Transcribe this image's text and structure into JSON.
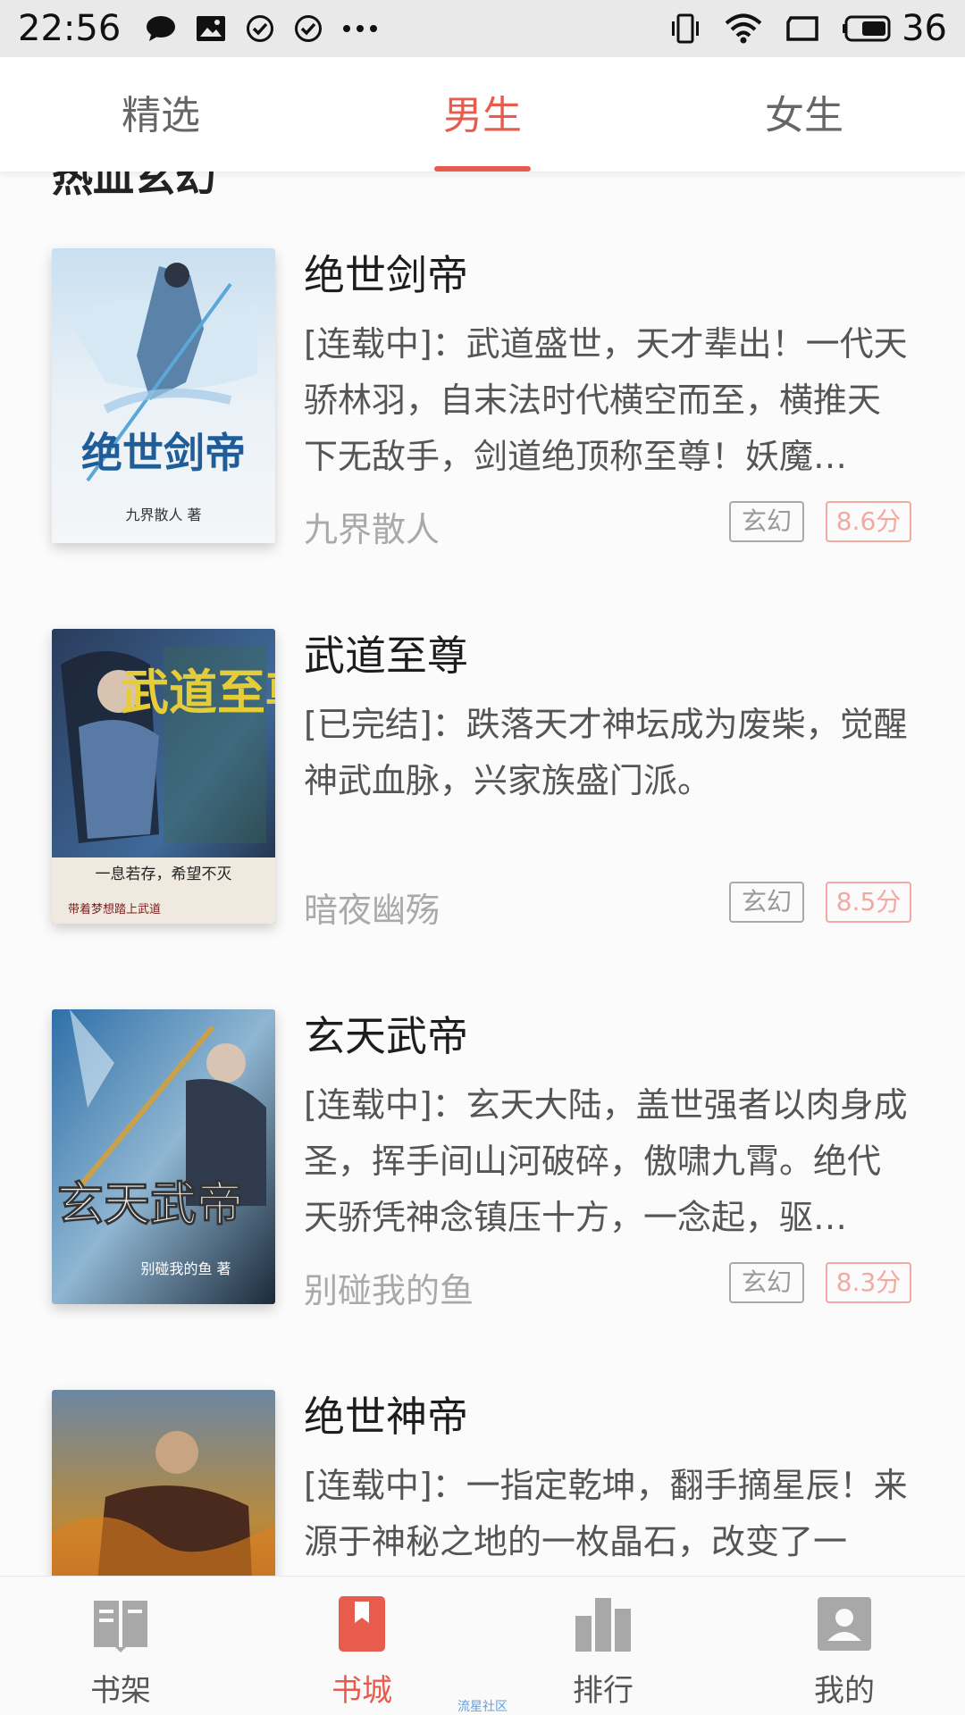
{
  "status_bar": {
    "time": "22:56",
    "icons": [
      "chat-bubble-icon",
      "image-notification-icon",
      "check-circle-icon",
      "check-circle-icon",
      "more-dots-icon"
    ],
    "right_icons": [
      "vibrate-icon",
      "wifi-icon",
      "screen-icon",
      "battery-icon"
    ],
    "battery_level": "36"
  },
  "tabs": [
    {
      "label": "精选",
      "active": false
    },
    {
      "label": "男生",
      "active": true
    },
    {
      "label": "女生",
      "active": false
    }
  ],
  "section": {
    "title": "热血玄幻"
  },
  "books": [
    {
      "title": "绝世剑帝",
      "description": "[连载中]：武道盛世，天才辈出！一代天骄林羽，自末法时代横空而至，横推天下无敌手，剑道绝顶称至尊！妖魔…",
      "author": "九界散人",
      "genre": "玄幻",
      "score": "8.6分",
      "cover_text": "绝世剑帝",
      "cover_author": "九界散人 著"
    },
    {
      "title": "武道至尊",
      "description": "[已完结]：跌落天才神坛成为废柴，觉醒神武血脉，兴家族盛门派。",
      "author": "暗夜幽殇",
      "genre": "玄幻",
      "score": "8.5分",
      "cover_text": "武道至尊",
      "cover_tagline": "一息若存，希望不灭",
      "cover_bottom": "带着梦想踏上武道"
    },
    {
      "title": "玄天武帝",
      "description": "[连载中]：玄天大陆，盖世强者以肉身成圣，挥手间山河破碎，傲啸九霄。绝代天骄凭神念镇压十方，一念起，驱…",
      "author": "别碰我的鱼",
      "genre": "玄幻",
      "score": "8.3分",
      "cover_text": "玄天武帝",
      "cover_author": "别碰我的鱼 著"
    },
    {
      "title": "绝世神帝",
      "description": "[连载中]：一指定乾坤，翻手摘星辰！来源于神秘之地的一枚晶石，改变了一",
      "author": "",
      "genre": "",
      "score": ""
    }
  ],
  "bottom_nav": [
    {
      "label": "书架",
      "icon": "bookshelf-icon",
      "active": false
    },
    {
      "label": "书城",
      "icon": "bookstore-icon",
      "active": true
    },
    {
      "label": "排行",
      "icon": "ranking-icon",
      "active": false
    },
    {
      "label": "我的",
      "icon": "profile-icon",
      "active": false
    }
  ],
  "watermark": "流星社区",
  "colors": {
    "accent": "#e85c4e",
    "score_tag": "#f2a9a2",
    "status_bar_bg": "#e9e9e9",
    "nav_icon": "#a8a8a8"
  }
}
